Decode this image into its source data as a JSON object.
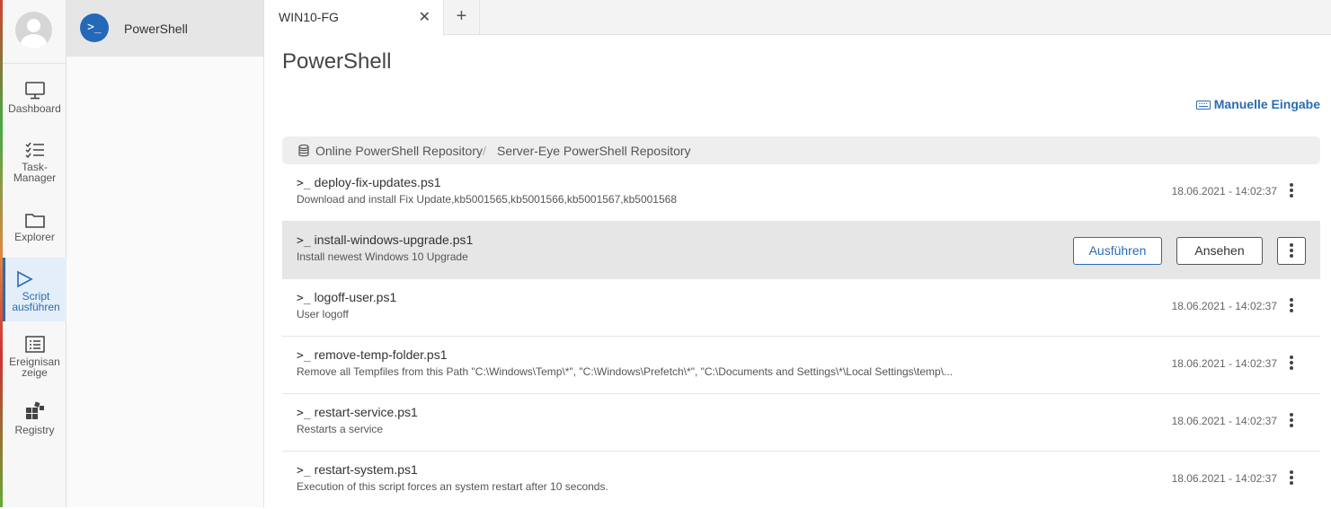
{
  "nav": {
    "items": [
      {
        "label_line1": "Dashboard",
        "label_line2": "",
        "icon": "monitor-icon"
      },
      {
        "label_line1": "Task-",
        "label_line2": "Manager",
        "icon": "checklist-icon"
      },
      {
        "label_line1": "Explorer",
        "label_line2": "",
        "icon": "folder-icon"
      },
      {
        "label_line1": "Script",
        "label_line2": "ausführen",
        "icon": "play-icon"
      },
      {
        "label_line1": "Ereignisan",
        "label_line2": "zeige",
        "icon": "event-list-icon"
      },
      {
        "label_line1": "Registry",
        "label_line2": "",
        "icon": "registry-icon"
      }
    ]
  },
  "subnav": {
    "label": "PowerShell",
    "icon_text": ">_"
  },
  "tabs": {
    "title": "WIN10-FG",
    "close": "✕",
    "add": "+"
  },
  "page": {
    "title": "PowerShell",
    "manual_input": "Manuelle Eingabe"
  },
  "breadcrumb": {
    "item1": "Online PowerShell Repository",
    "separator": "/",
    "item2": "Server-Eye PowerShell Repository"
  },
  "scripts": [
    {
      "prompt": ">_",
      "name": "deploy-fix-updates.ps1",
      "desc": "Download and install Fix Update,kb5001565,kb5001566,kb5001567,kb5001568",
      "date": "18.06.2021 - 14:02:37"
    },
    {
      "prompt": ">_",
      "name": "install-windows-upgrade.ps1",
      "desc": "Install newest Windows 10 Upgrade",
      "date": ""
    },
    {
      "prompt": ">_",
      "name": "logoff-user.ps1",
      "desc": "User logoff",
      "date": "18.06.2021 - 14:02:37"
    },
    {
      "prompt": ">_",
      "name": "remove-temp-folder.ps1",
      "desc": "Remove all Tempfiles from this Path \"C:\\Windows\\Temp\\*\", \"C:\\Windows\\Prefetch\\*\", \"C:\\Documents and Settings\\*\\Local Settings\\temp\\...",
      "date": "18.06.2021 - 14:02:37"
    },
    {
      "prompt": ">_",
      "name": "restart-service.ps1",
      "desc": "Restarts a service",
      "date": "18.06.2021 - 14:02:37"
    },
    {
      "prompt": ">_",
      "name": "restart-system.ps1",
      "desc": "Execution of this script forces an system restart after 10 seconds.",
      "date": "18.06.2021 - 14:02:37"
    }
  ],
  "actions": {
    "run": "Ausführen",
    "view": "Ansehen"
  },
  "colors": {
    "accent": "#2b6cb0",
    "selected_row": "#e6e6e6"
  }
}
